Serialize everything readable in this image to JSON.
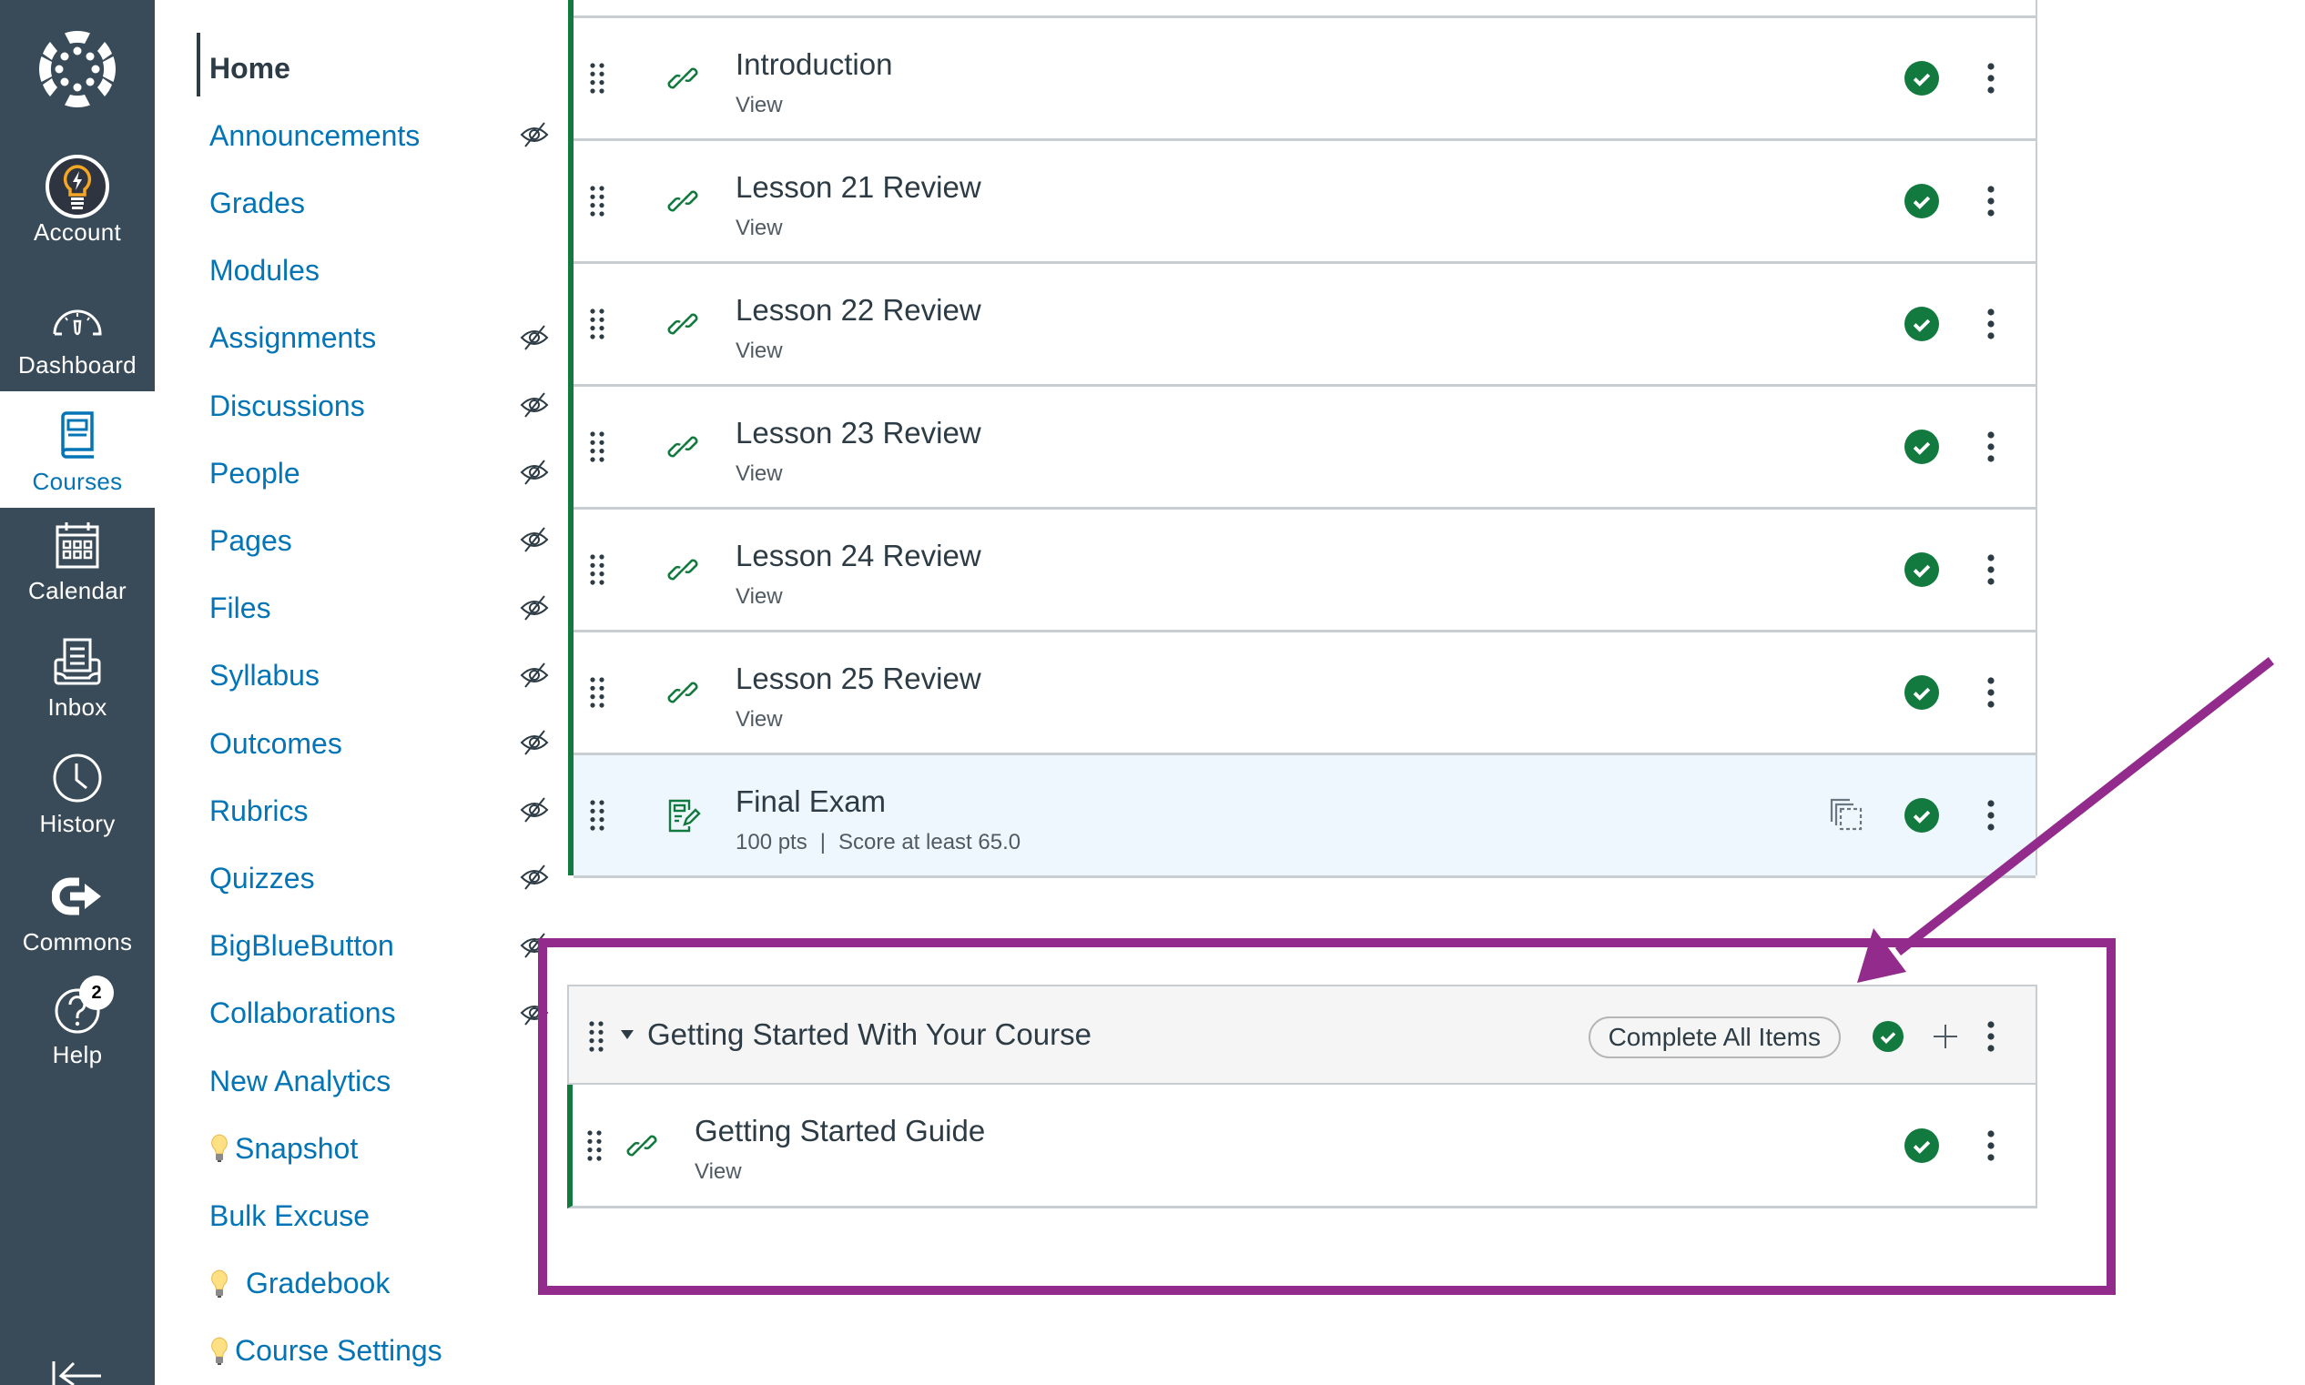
{
  "global_nav": {
    "logo": "canvas-logo-icon",
    "items": [
      {
        "label": "Account",
        "icon": "lightbulb-avatar-icon",
        "active": false
      },
      {
        "label": "Dashboard",
        "icon": "speedometer-icon",
        "active": false
      },
      {
        "label": "Courses",
        "icon": "book-icon",
        "active": true
      },
      {
        "label": "Calendar",
        "icon": "calendar-icon",
        "active": false
      },
      {
        "label": "Inbox",
        "icon": "inbox-icon",
        "active": false
      },
      {
        "label": "History",
        "icon": "clock-icon",
        "active": false
      },
      {
        "label": "Commons",
        "icon": "commons-icon",
        "active": false
      },
      {
        "label": "Help",
        "icon": "help-icon",
        "badge": "2",
        "active": false
      }
    ],
    "collapse_icon": "collapse-arrow-icon"
  },
  "course_nav": {
    "items": [
      {
        "label": "Home",
        "active": true,
        "hidden": false
      },
      {
        "label": "Announcements",
        "hidden": true
      },
      {
        "label": "Grades",
        "hidden": false
      },
      {
        "label": "Modules",
        "hidden": false
      },
      {
        "label": "Assignments",
        "hidden": true
      },
      {
        "label": "Discussions",
        "hidden": true
      },
      {
        "label": "People",
        "hidden": true
      },
      {
        "label": "Pages",
        "hidden": true
      },
      {
        "label": "Files",
        "hidden": true
      },
      {
        "label": "Syllabus",
        "hidden": true
      },
      {
        "label": "Outcomes",
        "hidden": true
      },
      {
        "label": "Rubrics",
        "hidden": true
      },
      {
        "label": "Quizzes",
        "hidden": true
      },
      {
        "label": "BigBlueButton",
        "hidden": true
      },
      {
        "label": "Collaborations",
        "hidden": true
      },
      {
        "label": "New Analytics",
        "hidden": false
      },
      {
        "label": "Snapshot",
        "bulb": true,
        "hidden": false
      },
      {
        "label": "Bulk Excuse",
        "hidden": false
      },
      {
        "label": "Gradebook",
        "bulb": true,
        "hidden": false
      },
      {
        "label": "Course Settings",
        "bulb": true,
        "hidden": false
      }
    ]
  },
  "module_items": [
    {
      "title": "Introduction",
      "type": "external-link",
      "subtitle": "View",
      "completed": true
    },
    {
      "title": "Lesson 21 Review",
      "type": "external-link",
      "subtitle": "View",
      "completed": true
    },
    {
      "title": "Lesson 22 Review",
      "type": "external-link",
      "subtitle": "View",
      "completed": true
    },
    {
      "title": "Lesson 23 Review",
      "type": "external-link",
      "subtitle": "View",
      "completed": true
    },
    {
      "title": "Lesson 24 Review",
      "type": "external-link",
      "subtitle": "View",
      "completed": true
    },
    {
      "title": "Lesson 25 Review",
      "type": "external-link",
      "subtitle": "View",
      "completed": true
    },
    {
      "title": "Final Exam",
      "type": "quiz",
      "points": "100 pts",
      "requirement": "Score at least 65.0",
      "completed": true,
      "highlighted": true
    }
  ],
  "module2": {
    "title": "Getting Started With Your Course",
    "complete_button": "Complete All Items",
    "items": [
      {
        "title": "Getting Started Guide",
        "type": "external-link",
        "subtitle": "View",
        "completed": true
      }
    ]
  },
  "colors": {
    "nav_bg": "#394B58",
    "link_blue": "#0374B5",
    "success_green": "#127A3E",
    "annotation_purple": "#922B8C",
    "text_dark": "#2D3B45"
  }
}
